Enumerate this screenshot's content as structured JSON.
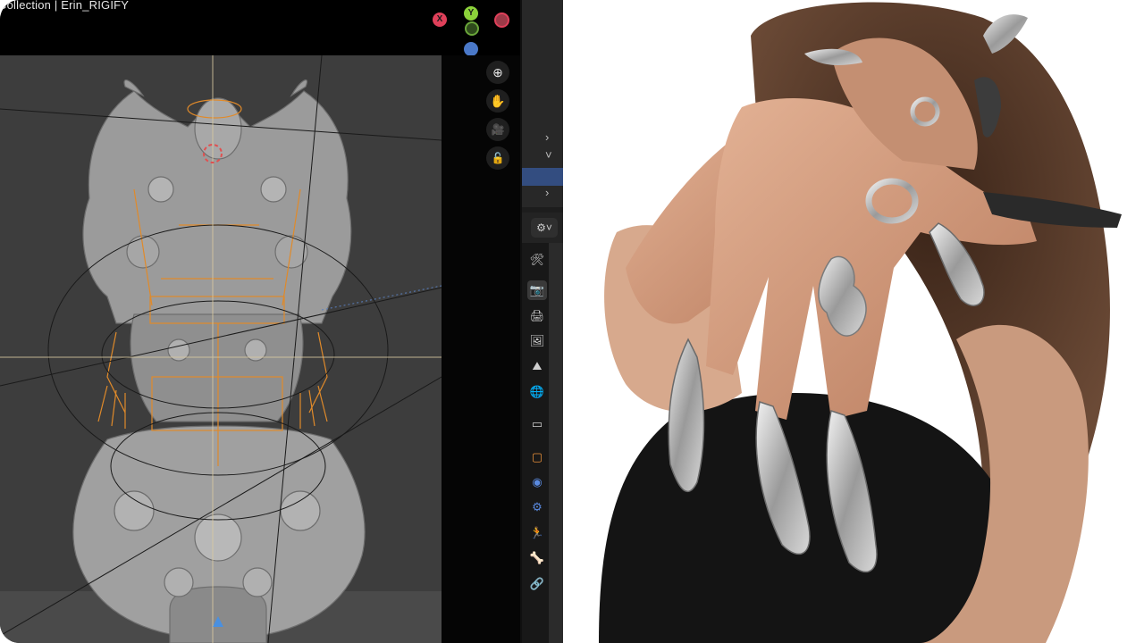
{
  "viewport": {
    "breadcrumb": "Collection | Erin_RIGIFY",
    "gizmo": {
      "x_label": "X",
      "y_label": "Y",
      "x_color": "#e0405a",
      "y_color": "#8cd23a",
      "z_color": "#4a78c8"
    },
    "nav": [
      {
        "name": "zoom-icon",
        "glyph": "⊕"
      },
      {
        "name": "hand-pan-icon",
        "glyph": "✋"
      },
      {
        "name": "camera-view-icon",
        "glyph": "🎥"
      },
      {
        "name": "lock-icon",
        "glyph": "🔓"
      }
    ]
  },
  "properties": {
    "editor_glyph": "⚙︎˅",
    "tabs": [
      {
        "name": "tool-tab-icon",
        "glyph": "🛠",
        "color": "#cfcfcf"
      },
      {
        "name": "render-tab-icon",
        "glyph": "📷",
        "color": "#cfcfcf"
      },
      {
        "name": "output-tab-icon",
        "glyph": "🖨",
        "color": "#cfcfcf"
      },
      {
        "name": "view-layer-tab-icon",
        "glyph": "🖼",
        "color": "#cfcfcf"
      },
      {
        "name": "scene-tab-icon",
        "glyph": "⛰",
        "color": "#cfcfcf"
      },
      {
        "name": "world-tab-icon",
        "glyph": "🌐",
        "color": "#d24a4a"
      },
      {
        "name": "collection-tab-icon",
        "glyph": "▭",
        "color": "#cfcfcf"
      },
      {
        "name": "object-tab-icon",
        "glyph": "▢",
        "color": "#e8903a"
      },
      {
        "name": "modifier-tab-icon",
        "glyph": "◉",
        "color": "#5a8ae0"
      },
      {
        "name": "particles-tab-icon",
        "glyph": "⚙",
        "color": "#5a8ae0"
      },
      {
        "name": "physics-tab-icon",
        "glyph": "🏃",
        "color": "#3ac07a"
      },
      {
        "name": "bone-tab-icon",
        "glyph": "🦴",
        "color": "#3ac07a"
      },
      {
        "name": "constraint-tab-icon",
        "glyph": "🔗",
        "color": "#5a8ae0"
      }
    ]
  }
}
